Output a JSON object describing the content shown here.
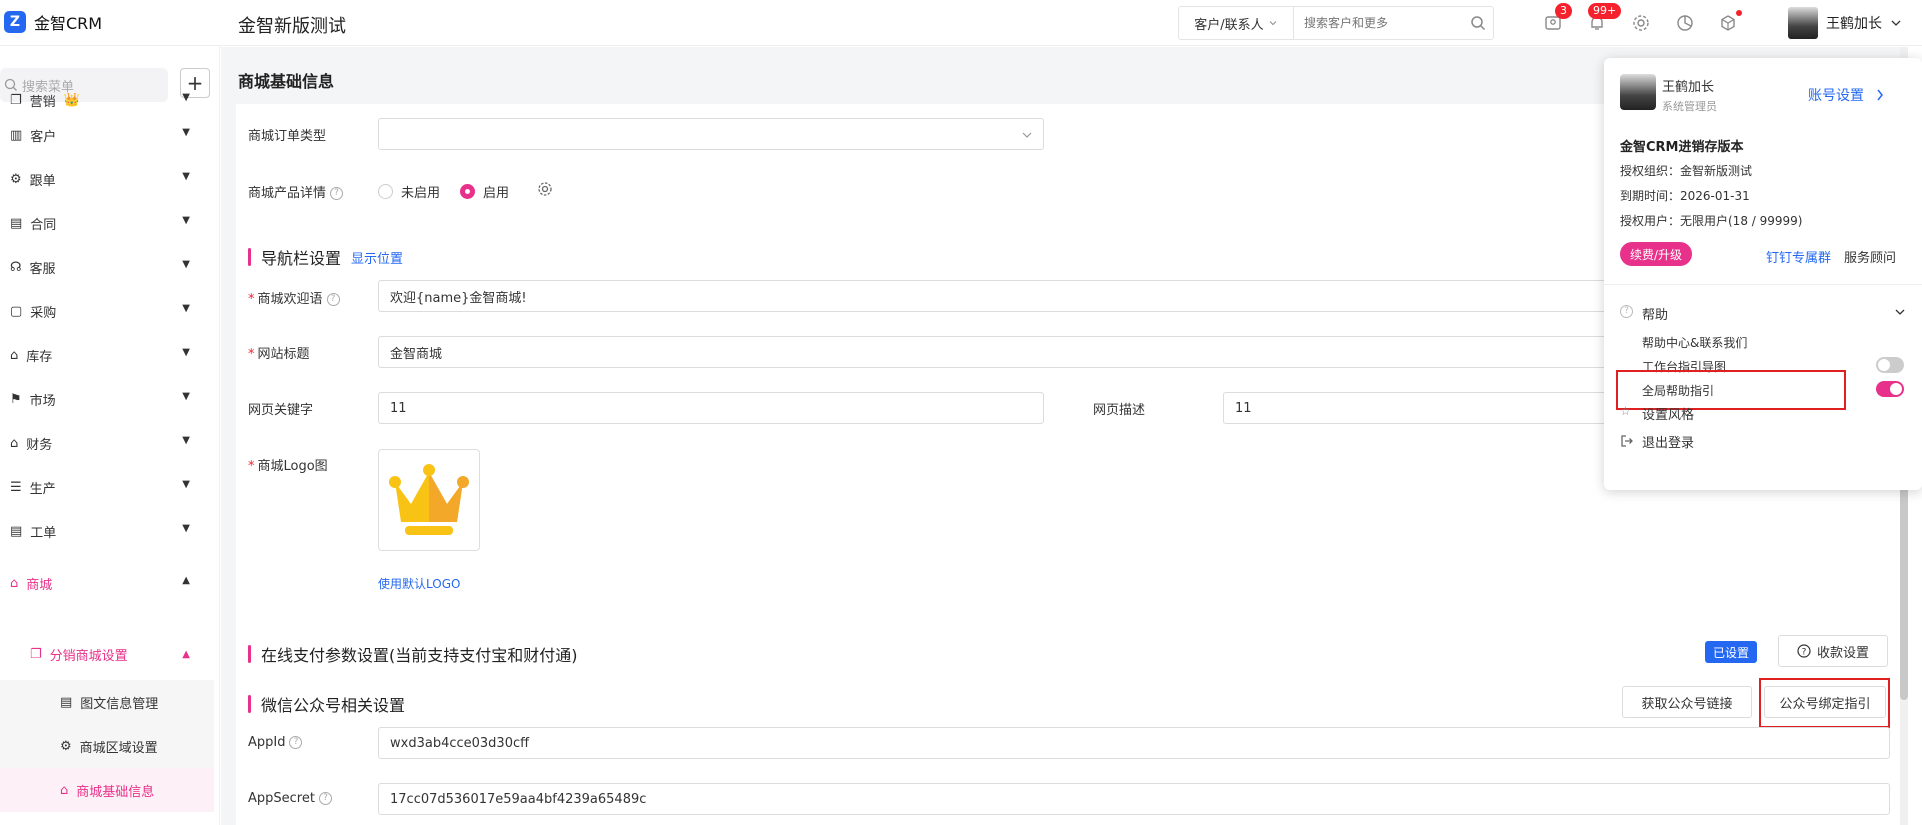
{
  "header": {
    "logo_text": "金智CRM",
    "org_title": "金智新版测试",
    "search_scope": "客户/联系人",
    "search_placeholder": "搜索客户和更多",
    "badge_messages": "3",
    "badge_notifications": "99+",
    "user_name": "王鹤加长"
  },
  "sidebar": {
    "search_placeholder": "搜索菜单",
    "add_label": "+",
    "items": [
      {
        "label": "营销",
        "icon": "copy-icon"
      },
      {
        "label": "客户",
        "icon": "building-icon"
      },
      {
        "label": "跟单",
        "icon": "gear-icon"
      },
      {
        "label": "合同",
        "icon": "contract-icon"
      },
      {
        "label": "客服",
        "icon": "headset-icon"
      },
      {
        "label": "采购",
        "icon": "bag-icon"
      },
      {
        "label": "库存",
        "icon": "warehouse-icon"
      },
      {
        "label": "市场",
        "icon": "flag-icon"
      },
      {
        "label": "财务",
        "icon": "home-icon"
      },
      {
        "label": "生产",
        "icon": "list-icon"
      },
      {
        "label": "工单",
        "icon": "doc-icon"
      },
      {
        "label": "商城",
        "icon": "shop-icon"
      }
    ],
    "sub_group": "分销商城设置",
    "sub_items": [
      "图文信息管理",
      "商城区域设置",
      "商城基础信息"
    ]
  },
  "page": {
    "title": "商城基础信息",
    "order_type_label": "商城订单类型",
    "product_detail_label": "商城产品详情",
    "radio_off": "未启用",
    "radio_on": "启用",
    "nav_section": "导航栏设置",
    "nav_link": "显示位置",
    "welcome_label": "商城欢迎语",
    "welcome_value": "欢迎{name}金智商城!",
    "site_title_label": "网站标题",
    "site_title_value": "金智商城",
    "keywords_label": "网页关键字",
    "keywords_value": "11",
    "desc_label": "网页描述",
    "desc_value": "11",
    "logo_label": "商城Logo图",
    "logo_default_link": "使用默认LOGO",
    "pay_section": "在线支付参数设置(当前支持支付宝和财付通)",
    "pay_tag": "已设置",
    "pay_button": "收款设置",
    "wechat_section": "微信公众号相关设置",
    "wechat_link_btn": "获取公众号链接",
    "wechat_guide_btn": "公众号绑定指引",
    "appid_label": "AppId",
    "appid_value": "wxd3ab4cce03d30cff",
    "appsecret_label": "AppSecret",
    "appsecret_value": "17cc07d536017e59aa4bf4239a65489c"
  },
  "popup": {
    "user_name": "王鹤加长",
    "role": "系统管理员",
    "account_settings": "账号设置",
    "edition": "金智CRM进销存版本",
    "org": "授权组织：金智新版测试",
    "expire": "到期时间：2026-01-31",
    "users": "授权用户：无限用户(18 / 99999)",
    "renew": "续费/升级",
    "dingtalk": "钉钉专属群",
    "advisor": "服务顾问",
    "help": "帮助",
    "help_center": "帮助中心&联系我们",
    "workbench_guide": "工作台指引导图",
    "global_guide": "全局帮助指引",
    "theme": "设置风格",
    "logout": "退出登录",
    "workbench_guide_on": false,
    "global_guide_on": true
  },
  "colors": {
    "accent": "#e8318a",
    "brand": "#2468f2",
    "highlight_box": "#e02020"
  }
}
